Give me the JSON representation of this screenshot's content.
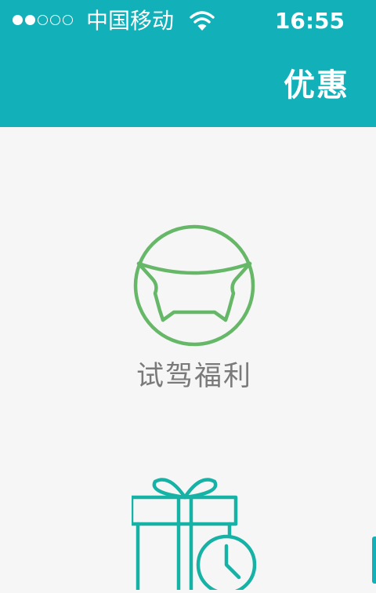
{
  "status_bar": {
    "signal_filled": 2,
    "signal_total": 5,
    "carrier": "中国移动",
    "wifi_icon": "wifi-icon",
    "time": "16:55"
  },
  "header": {
    "title": "优惠",
    "background": "#12b0b8"
  },
  "features": [
    {
      "label": "试驾福利",
      "icon": "steering-wheel-icon",
      "color": "#66b868"
    },
    {
      "label": "",
      "icon": "gift-clock-icon",
      "color": "#17b2a6"
    }
  ]
}
